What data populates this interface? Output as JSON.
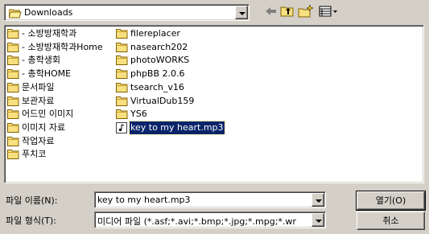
{
  "lookin": {
    "value": "Downloads"
  },
  "files": [
    {
      "name": "- 소방방재학과",
      "type": "folder"
    },
    {
      "name": "- 소방방재학과Home",
      "type": "folder"
    },
    {
      "name": "- 총학생회",
      "type": "folder"
    },
    {
      "name": "- 총학HOME",
      "type": "folder"
    },
    {
      "name": "문서파일",
      "type": "folder"
    },
    {
      "name": "보관자료",
      "type": "folder"
    },
    {
      "name": "어드민 이미지",
      "type": "folder"
    },
    {
      "name": "이미지 자료",
      "type": "folder"
    },
    {
      "name": "작업자료",
      "type": "folder"
    },
    {
      "name": "푸치코",
      "type": "folder"
    },
    {
      "name": "filereplacer",
      "type": "folder"
    },
    {
      "name": "nasearch202",
      "type": "folder"
    },
    {
      "name": "photoWORKS",
      "type": "folder"
    },
    {
      "name": "phpBB 2.0.6",
      "type": "folder"
    },
    {
      "name": "tsearch_v16",
      "type": "folder"
    },
    {
      "name": "VirtualDub159",
      "type": "folder"
    },
    {
      "name": "YS6",
      "type": "folder"
    },
    {
      "name": "key to my heart.mp3",
      "type": "mp3",
      "selected": true
    }
  ],
  "filename": {
    "label": "파일 이름(N):",
    "value": "key to my heart.mp3"
  },
  "filetype": {
    "label": "파일 형식(T):",
    "value": "미디어 파일 (*.asf;*.avi;*.bmp;*.jpg;*.mpg;*.wr"
  },
  "buttons": {
    "open": "열기(O)",
    "cancel": "취소"
  }
}
